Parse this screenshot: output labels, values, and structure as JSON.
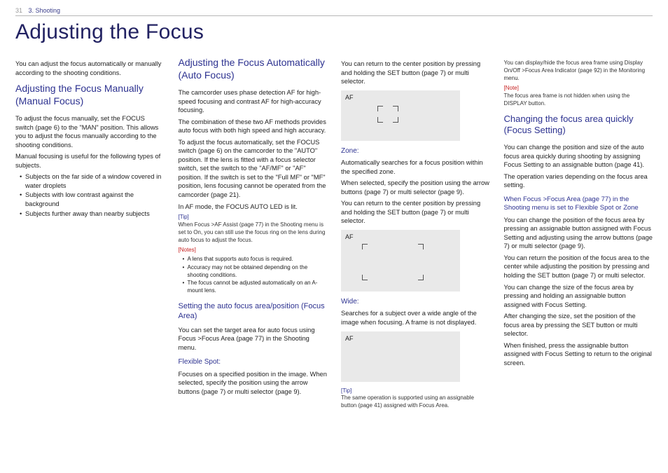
{
  "top": {
    "page": "31",
    "crumb": "3. Shooting"
  },
  "title": "Adjusting the Focus",
  "col1": {
    "intro": "You can adjust the focus automatically or manually according to the shooting conditions.",
    "manual_h": "Adjusting the Focus Manually (Manual Focus)",
    "manual_p1": "To adjust the focus manually, set the FOCUS switch (page 6) to the \"MAN\" position. This allows you to adjust the focus manually according to the shooting conditions.",
    "manual_p2": "Manual focusing is useful for the following types of subjects.",
    "bul": [
      "Subjects on the far side of a window covered in water droplets",
      "Subjects with low contrast against the background",
      "Subjects further away than nearby subjects"
    ]
  },
  "col2": {
    "auto_h": "Adjusting the Focus Automatically (Auto Focus)",
    "p1": "The camcorder uses phase detection AF for high-speed focusing and contrast AF for high-accuracy focusing.",
    "p2": "The combination of these two AF methods provides auto focus with both high speed and high accuracy.",
    "p3": "To adjust the focus automatically, set the FOCUS switch (page 6) on the camcorder to the \"AUTO\" position. If the lens is fitted with a focus selector switch, set the switch to the \"AF/MF\" or \"AF\" position. If the switch is set to the \"Full MF\" or \"MF\" position, lens focusing cannot be operated from the camcorder (page 21).",
    "p4": "In AF mode, the FOCUS AUTO LED is lit.",
    "tip_lbl": "[Tip]",
    "tip_txt": "When Focus >AF Assist (page 77) in the Shooting menu is set to On, you can still use the focus ring on the lens during auto focus to adjust the focus.",
    "notes_lbl": "[Notes]",
    "notes": [
      "A lens that supports auto focus is required.",
      "Accuracy may not be obtained depending on the shooting conditions.",
      "The focus cannot be adjusted automatically on an A-mount lens."
    ],
    "area_h": "Setting the auto focus area/position (Focus Area)",
    "area_p": "You can set the target area for auto focus using Focus >Focus Area (page 77) in the Shooting menu.",
    "flex_h": "Flexible Spot:",
    "flex_p": "Focuses on a specified position in the image. When selected, specify the position using the arrow buttons (page 7) or multi selector (page 9)."
  },
  "col3": {
    "top_p": "You can return to the center position by pressing and holding the SET button (page 7) or multi selector.",
    "af_lbl": "AF",
    "zone_h": "Zone:",
    "zone_p1": "Automatically searches for a focus position within the specified zone.",
    "zone_p2": "When selected, specify the position using the arrow buttons (page 7) or multi selector (page 9).",
    "zone_p3": "You can return to the center position by pressing and holding the SET button (page 7) or multi selector.",
    "wide_h": "Wide:",
    "wide_p": "Searches for a subject over a wide angle of the image when focusing. A frame is not displayed.",
    "tip_lbl": "[Tip]",
    "tip_txt": "The same operation is supported using an assignable button (page 41) assigned with Focus Area."
  },
  "col4": {
    "top_p": "You can display/hide the focus area frame using Display On/Off >Focus Area Indicator (page 92) in the Monitoring menu.",
    "note_lbl": "[Note]",
    "note_txt": "The focus area frame is not hidden when using the DISPLAY button.",
    "quick_h": "Changing the focus area quickly (Focus Setting)",
    "quick_p1": "You can change the position and size of the auto focus area quickly during shooting by assigning Focus Setting to an assignable button (page 41).",
    "quick_p2": "The operation varies depending on the focus area setting.",
    "sub_h": "When Focus >Focus Area (page 77) in the Shooting menu is set to Flexible Spot or Zone",
    "sub_p1": "You can change the position of the focus area by pressing an assignable button assigned with Focus Setting and adjusting using the arrow buttons (page 7) or multi selector (page 9).",
    "sub_p2": "You can return the position of the focus area to the center while adjusting the position by pressing and holding the SET button (page 7) or multi selector.",
    "sub_p3": "You can change the size of the focus area by pressing and holding an assignable button assigned with Focus Setting.",
    "sub_p4": "After changing the size, set the position of the focus area by pressing the SET button or multi selector.",
    "sub_p5": "When finished, press the assignable button assigned with Focus Setting to return to the original screen."
  }
}
